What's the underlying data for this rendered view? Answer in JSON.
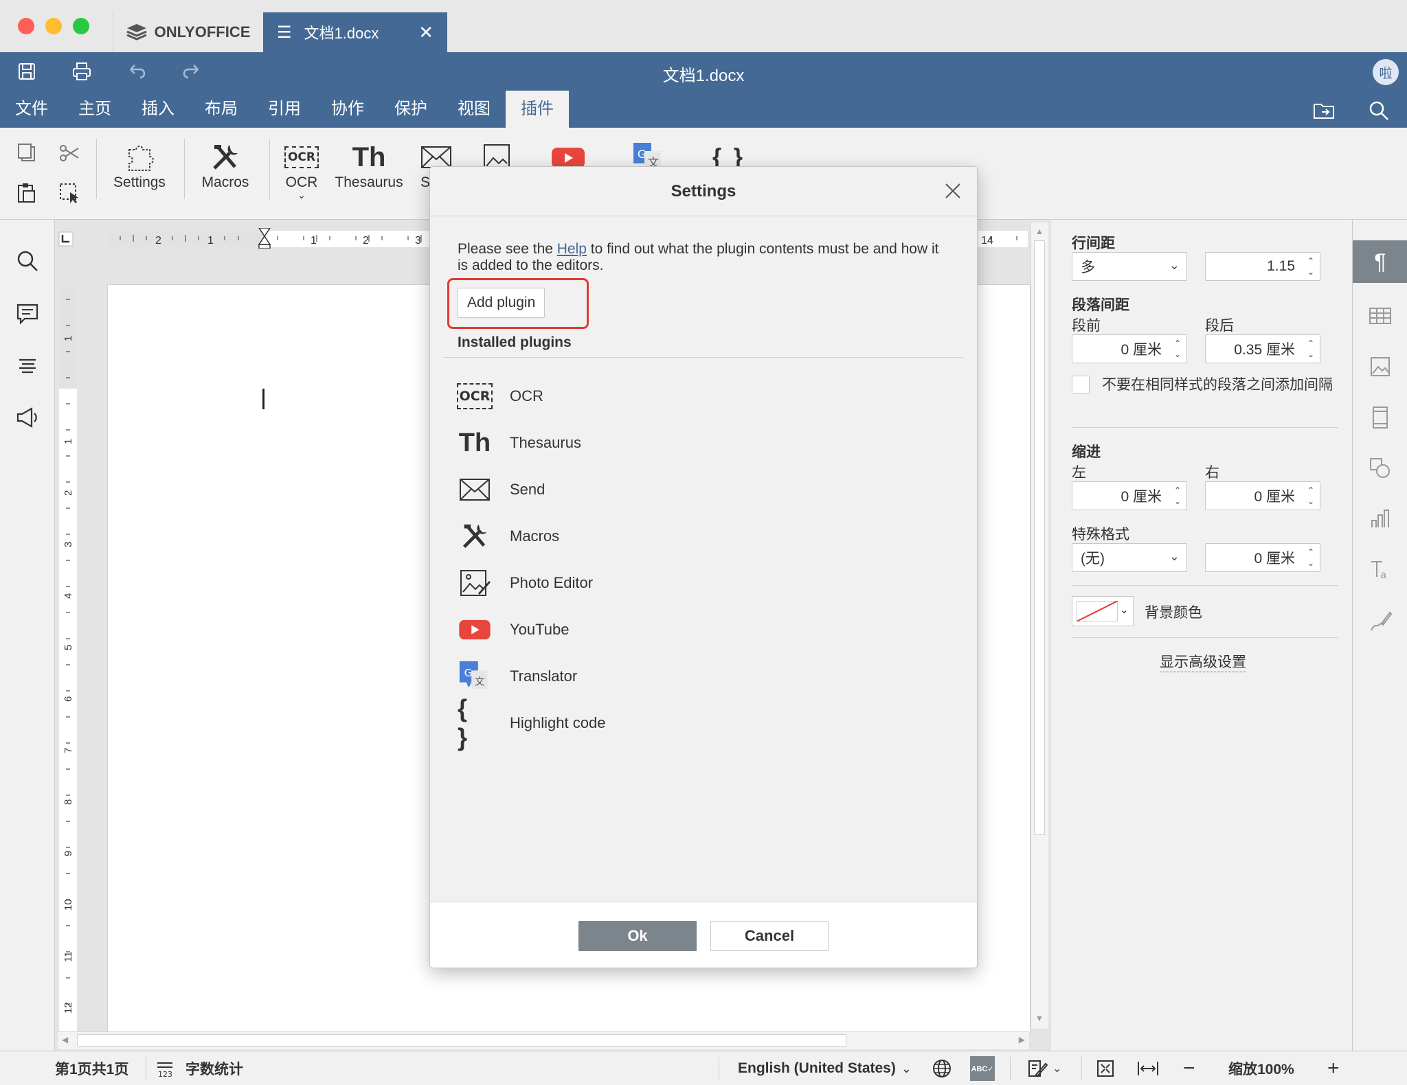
{
  "titlebar": {
    "home_tab": "ONLYOFFICE",
    "doc_tab": "文档1.docx"
  },
  "header": {
    "title": "文档1.docx",
    "avatar": "啦",
    "menu": [
      "文件",
      "主页",
      "插入",
      "布局",
      "引用",
      "协作",
      "保护",
      "视图",
      "插件"
    ],
    "active_menu": "插件"
  },
  "toolbar": {
    "settings_label": "Settings",
    "macros_label": "Macros",
    "ocr_label": "OCR",
    "ocr_icon_text": "OCR",
    "thesaurus_label": "Thesaurus",
    "thesaurus_icon_text": "Th",
    "send_label_partial": "S",
    "highlight_icon_text": "{ }"
  },
  "ruler": {
    "h_numbers": [
      "2",
      "1",
      "1",
      "2",
      "3",
      "14"
    ],
    "v_numbers": [
      "1",
      "1",
      "2",
      "3",
      "4",
      "5",
      "6",
      "7",
      "8",
      "9",
      "10",
      "11",
      "12"
    ]
  },
  "right_panel": {
    "line_spacing_label": "行间距",
    "line_spacing_type": "多",
    "line_spacing_value": "1.15",
    "para_spacing_label": "段落间距",
    "before_label": "段前",
    "after_label": "段后",
    "before_value": "0 厘米",
    "after_value": "0.35 厘米",
    "no_space_checkbox": "不要在相同样式的段落之间添加间隔",
    "indent_label": "缩进",
    "left_label": "左",
    "right_label": "右",
    "left_value": "0 厘米",
    "right_value": "0 厘米",
    "special_label": "特殊格式",
    "special_value": "(无)",
    "special_amount": "0 厘米",
    "bg_color_label": "背景颜色",
    "advanced_link": "显示高级设置"
  },
  "statusbar": {
    "page_info": "第1页共1页",
    "word_count": "字数统计",
    "language": "English (United States)",
    "zoom": "缩放100%"
  },
  "dialog": {
    "title": "Settings",
    "help_prefix": "Please see the ",
    "help_link": "Help",
    "help_suffix": " to find out what the plugin contents must be and how it is added to the editors.",
    "add_plugin": "Add plugin",
    "installed_title": "Installed plugins",
    "plugins": [
      {
        "name": "OCR",
        "icon": "ocr-icon"
      },
      {
        "name": "Thesaurus",
        "icon": "thesaurus-icon"
      },
      {
        "name": "Send",
        "icon": "envelope-icon"
      },
      {
        "name": "Macros",
        "icon": "tools-icon"
      },
      {
        "name": "Photo Editor",
        "icon": "photo-editor-icon"
      },
      {
        "name": "YouTube",
        "icon": "youtube-icon"
      },
      {
        "name": "Translator",
        "icon": "translator-icon"
      },
      {
        "name": "Highlight code",
        "icon": "braces-icon"
      }
    ],
    "ok": "Ok",
    "cancel": "Cancel"
  },
  "colors": {
    "accent": "#446995",
    "highlight_border": "#e03a2e",
    "youtube_red": "#e8453c",
    "ok_button": "#7d858c"
  }
}
